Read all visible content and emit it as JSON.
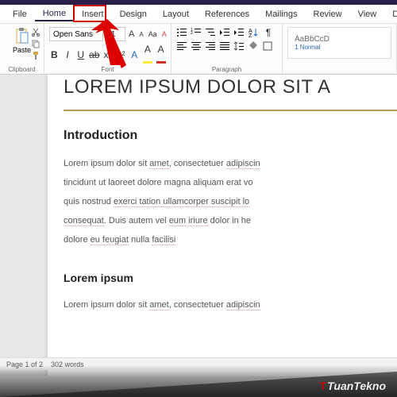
{
  "menu": {
    "file": "File",
    "home": "Home",
    "insert": "Insert",
    "design": "Design",
    "layout": "Layout",
    "references": "References",
    "mailings": "Mailings",
    "review": "Review",
    "view": "View",
    "develop": "Develo"
  },
  "ribbon": {
    "clipboard": {
      "paste": "Paste",
      "label": "Clipboard"
    },
    "font": {
      "name": "Open Sans",
      "size": "11",
      "label": "Font",
      "bold": "B",
      "italic": "I",
      "underline": "U",
      "strike": "ab",
      "sub": "x₂",
      "sup": "x²",
      "case": "Aa",
      "clear": "A",
      "grow": "A",
      "shrink": "A",
      "highlight": "A",
      "color": "A"
    },
    "paragraph": {
      "label": "Paragraph"
    },
    "styles": {
      "preview": "AaBbCcD",
      "name": "1 Normal"
    }
  },
  "document": {
    "title": "LOREM IPSUM DOLOR SIT A",
    "heading1": "Introduction",
    "para1a": "Lorem ipsum dolor sit ",
    "para1a_m": "amet",
    "para1b": ", consectetuer ",
    "para1b_m": "adipiscin",
    "para2": "tincidunt ut laoreet dolore magna aliquam erat vo",
    "para3a": "quis nostrud ",
    "para3a_m": "exerci tation ullamcorper suscipit lo",
    "para4a": "consequat",
    "para4b": ". Duis autem vel ",
    "para4c": "eum iriure",
    "para4d": " dolor in he",
    "para5a": "dolore ",
    "para5b": "eu feugiat",
    "para5c": " nulla ",
    "para5d": "facilisi",
    "heading2": "Lorem ipsum",
    "para6a": "Lorem ipsum dolor sit ",
    "para6b": "amet",
    "para6c": ", consectetuer ",
    "para6d": "adipiscin"
  },
  "status": {
    "page": "Page 1 of 2",
    "words": "302 words"
  },
  "watermark": {
    "brand_t": "T",
    "brand": "TuanTekno"
  }
}
